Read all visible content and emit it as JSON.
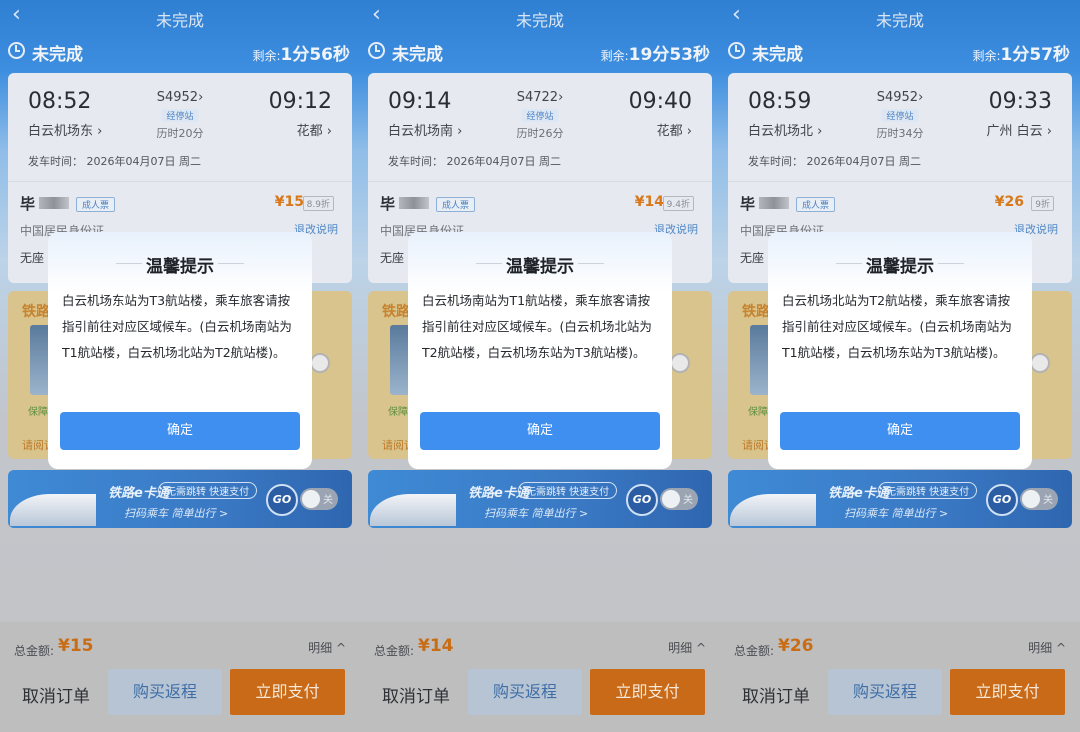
{
  "panels": [
    {
      "nav_title": "未完成",
      "status_label": "未完成",
      "remain_label": "剩余:",
      "remain_value": "1分56秒",
      "train": {
        "depart_time": "08:52",
        "depart_station": "白云机场东",
        "train_no": "S4952",
        "stops_label": "经停站",
        "duration": "历时20分",
        "arrive_time": "09:12",
        "arrive_station": "花都",
        "depart_date": "发车时间： 2026年04月07日 周二"
      },
      "passenger": {
        "name": "毕",
        "ticket_type": "成人票",
        "price": "¥15",
        "discount": "8.9折",
        "id_type": "中国居民身份证",
        "refund": "退改说明",
        "seat": "无座"
      },
      "insurance": {
        "title": "铁路",
        "tag": "保障",
        "note": "请阅读"
      },
      "banner": {
        "brand": "铁路e卡通",
        "chip": "无需跳转 快速支付",
        "slogan": "扫码乘车 简单出行 >",
        "go": "GO",
        "toggle": "关"
      },
      "bottom": {
        "total_label": "总金额:",
        "total_value": "¥15",
        "detail": "明细 ^",
        "cancel": "取消订单",
        "return": "购买返程",
        "pay": "立即支付"
      },
      "dialog": {
        "title": "温馨提示",
        "message": "白云机场东站为T3航站楼，乘车旅客请按指引前往对应区域候车。(白云机场南站为T1航站楼，白云机场北站为T2航站楼)。",
        "ok": "确定"
      }
    },
    {
      "nav_title": "未完成",
      "status_label": "未完成",
      "remain_label": "剩余:",
      "remain_value": "19分53秒",
      "train": {
        "depart_time": "09:14",
        "depart_station": "白云机场南",
        "train_no": "S4722",
        "stops_label": "经停站",
        "duration": "历时26分",
        "arrive_time": "09:40",
        "arrive_station": "花都",
        "depart_date": "发车时间： 2026年04月07日 周二"
      },
      "passenger": {
        "name": "毕",
        "ticket_type": "成人票",
        "price": "¥14",
        "discount": "9.4折",
        "id_type": "中国居民身份证",
        "refund": "退改说明",
        "seat": "无座"
      },
      "insurance": {
        "title": "铁路",
        "tag": "保障",
        "note": "请阅读"
      },
      "banner": {
        "brand": "铁路e卡通",
        "chip": "无需跳转 快速支付",
        "slogan": "扫码乘车 简单出行 >",
        "go": "GO",
        "toggle": "关"
      },
      "bottom": {
        "total_label": "总金额:",
        "total_value": "¥14",
        "detail": "明细 ^",
        "cancel": "取消订单",
        "return": "购买返程",
        "pay": "立即支付"
      },
      "dialog": {
        "title": "温馨提示",
        "message": "白云机场南站为T1航站楼，乘车旅客请按指引前往对应区域候车。(白云机场北站为T2航站楼，白云机场东站为T3航站楼)。",
        "ok": "确定"
      }
    },
    {
      "nav_title": "未完成",
      "status_label": "未完成",
      "remain_label": "剩余:",
      "remain_value": "1分57秒",
      "train": {
        "depart_time": "08:59",
        "depart_station": "白云机场北",
        "train_no": "S4952",
        "stops_label": "经停站",
        "duration": "历时34分",
        "arrive_time": "09:33",
        "arrive_station": "广州 白云",
        "depart_date": "发车时间： 2026年04月07日 周二"
      },
      "passenger": {
        "name": "毕",
        "ticket_type": "成人票",
        "price": "¥26",
        "discount": "9折",
        "id_type": "中国居民身份证",
        "refund": "退改说明",
        "seat": "无座"
      },
      "insurance": {
        "title": "铁路",
        "tag": "保障",
        "note": "请阅读"
      },
      "banner": {
        "brand": "铁路e卡通",
        "chip": "无需跳转 快速支付",
        "slogan": "扫码乘车 简单出行 >",
        "go": "GO",
        "toggle": "关"
      },
      "bottom": {
        "total_label": "总金额:",
        "total_value": "¥26",
        "detail": "明细 ^",
        "cancel": "取消订单",
        "return": "购买返程",
        "pay": "立即支付"
      },
      "dialog": {
        "title": "温馨提示",
        "message": "白云机场北站为T2航站楼，乘车旅客请按指引前往对应区域候车。(白云机场南站为T1航站楼，白云机场东站为T3航站楼)。",
        "ok": "确定"
      }
    }
  ]
}
